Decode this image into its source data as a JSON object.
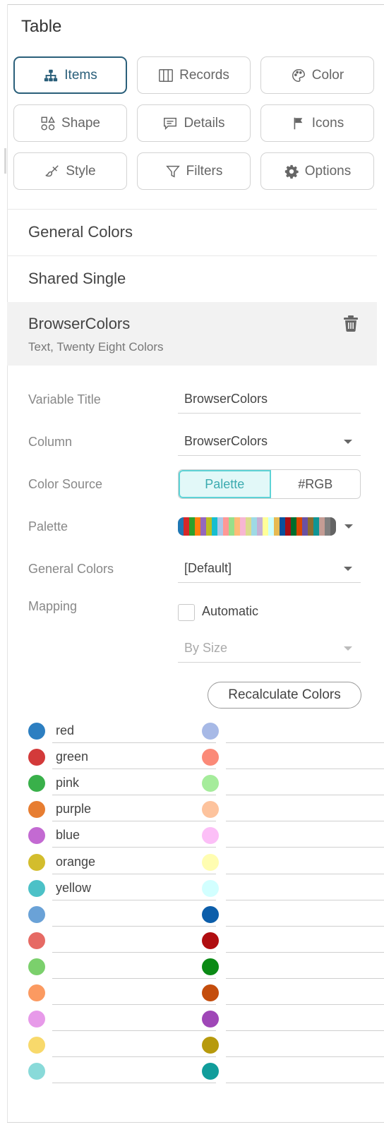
{
  "panel": {
    "title": "Table"
  },
  "toolbar": {
    "buttons": [
      {
        "label": "Items",
        "icon": "hierarchy-icon"
      },
      {
        "label": "Records",
        "icon": "columns-icon"
      },
      {
        "label": "Color",
        "icon": "palette-icon"
      },
      {
        "label": "Shape",
        "icon": "shapes-icon"
      },
      {
        "label": "Details",
        "icon": "comment-icon"
      },
      {
        "label": "Icons",
        "icon": "flag-icon"
      },
      {
        "label": "Style",
        "icon": "brush-icon"
      },
      {
        "label": "Filters",
        "icon": "funnel-icon"
      },
      {
        "label": "Options",
        "icon": "gear-icon"
      }
    ],
    "active_index": 0,
    "active_color": "#2a5f7a"
  },
  "variables": {
    "general_colors": "General Colors",
    "shared_single": "Shared Single",
    "selected": {
      "title": "BrowserColors",
      "subtitle": "Text, Twenty Eight Colors",
      "delete_icon": "trash-icon"
    }
  },
  "form": {
    "variable_title": {
      "label": "Variable Title",
      "value": "BrowserColors"
    },
    "column": {
      "label": "Column",
      "value": "BrowserColors"
    },
    "color_source": {
      "label": "Color Source",
      "options": [
        "Palette",
        "#RGB"
      ],
      "selected": "Palette"
    },
    "palette": {
      "label": "Palette"
    },
    "general_colors": {
      "label": "General Colors",
      "value": "[Default]"
    },
    "mapping": {
      "label": "Mapping",
      "automatic_label": "Automatic",
      "automatic_checked": false,
      "by": "By Size"
    },
    "recalculate": "Recalculate Colors"
  },
  "palette_colors": [
    "#1f77b4",
    "#d62728",
    "#2ca02c",
    "#ff7f0e",
    "#9467bd",
    "#bcbd22",
    "#17becf",
    "#aec7e8",
    "#ff9896",
    "#98df8a",
    "#ffbb78",
    "#f7b6d2",
    "#dbdb8d",
    "#9edae5",
    "#c5b0d5",
    "#ffff99",
    "#ccffff",
    "#e7ba52",
    "#08519c",
    "#a50f15",
    "#006d2c",
    "#d94801",
    "#6a51a3",
    "#8c6d31",
    "#0e9594",
    "#c49c94",
    "#7f7f7f",
    "#636363"
  ],
  "color_mappings": {
    "left": [
      {
        "color": "#2d7fc1",
        "value": "red"
      },
      {
        "color": "#d33a3a",
        "value": "green"
      },
      {
        "color": "#39b04a",
        "value": "pink"
      },
      {
        "color": "#e77d31",
        "value": "purple"
      },
      {
        "color": "#c36ad2",
        "value": "blue"
      },
      {
        "color": "#d3bd2d",
        "value": "orange"
      },
      {
        "color": "#4cc1c7",
        "value": "yellow"
      },
      {
        "color": "#6aa2d7",
        "value": ""
      },
      {
        "color": "#e66a64",
        "value": ""
      },
      {
        "color": "#7bd06c",
        "value": ""
      },
      {
        "color": "#fb9a61",
        "value": ""
      },
      {
        "color": "#e79ae9",
        "value": ""
      },
      {
        "color": "#f8d96b",
        "value": ""
      },
      {
        "color": "#89dad9",
        "value": ""
      }
    ],
    "right": [
      {
        "color": "#a7b9e6",
        "value": ""
      },
      {
        "color": "#fb8a78",
        "value": ""
      },
      {
        "color": "#a5ec9b",
        "value": ""
      },
      {
        "color": "#fdc39d",
        "value": ""
      },
      {
        "color": "#fcbff7",
        "value": ""
      },
      {
        "color": "#fffdb1",
        "value": ""
      },
      {
        "color": "#d2ffff",
        "value": ""
      },
      {
        "color": "#0c5eaa",
        "value": ""
      },
      {
        "color": "#b00d10",
        "value": ""
      },
      {
        "color": "#0b8a15",
        "value": ""
      },
      {
        "color": "#c44d0c",
        "value": ""
      },
      {
        "color": "#9f47b7",
        "value": ""
      },
      {
        "color": "#b79a0d",
        "value": ""
      },
      {
        "color": "#119d9b",
        "value": ""
      }
    ]
  }
}
